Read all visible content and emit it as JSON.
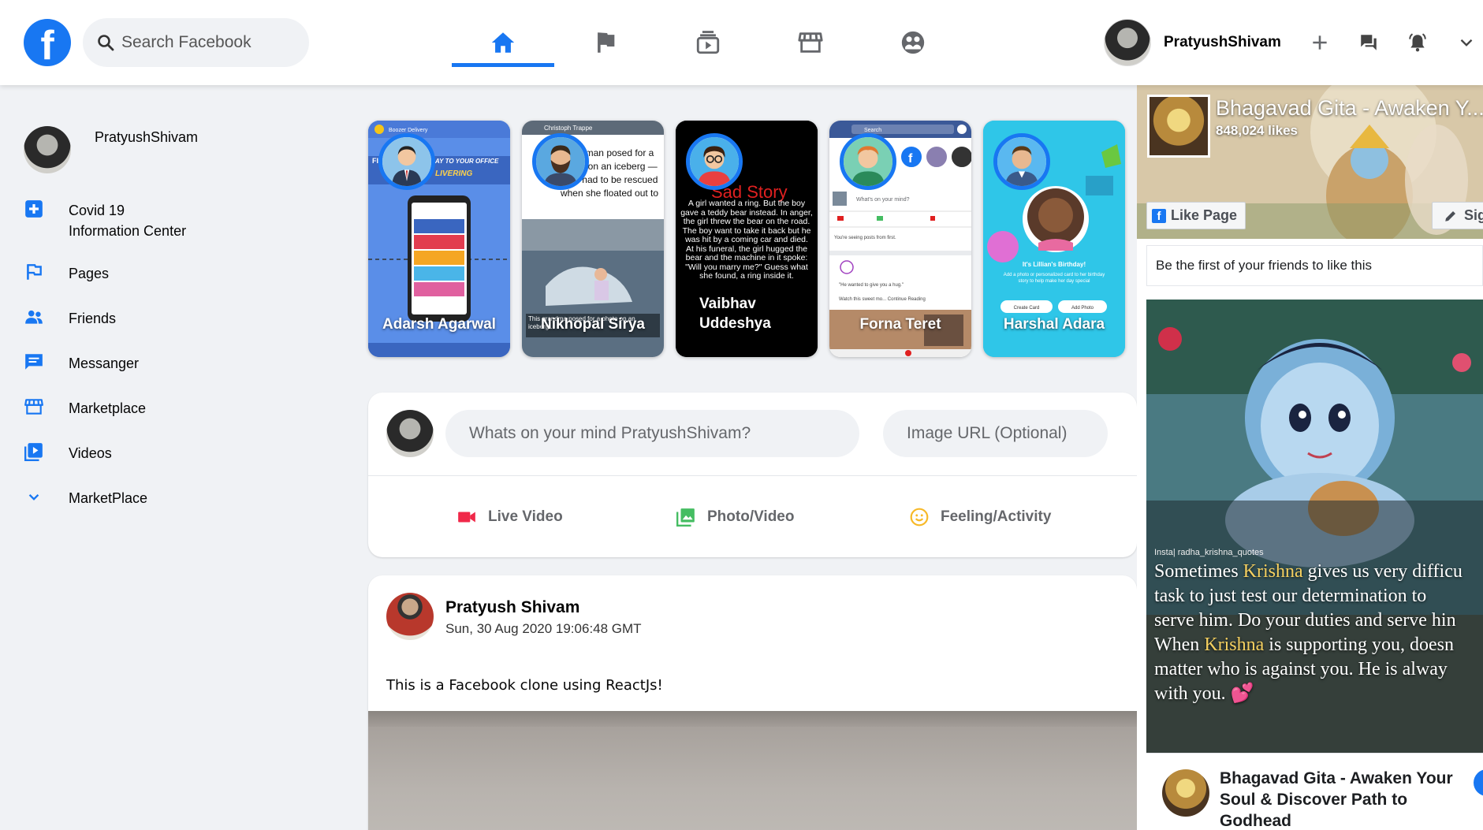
{
  "header": {
    "search_placeholder": "Search Facebook",
    "user_name": "PratyushShivam",
    "nav_tabs": [
      "home",
      "pages",
      "watch",
      "marketplace",
      "groups"
    ]
  },
  "sidebar": {
    "profile_name": "PratyushShivam",
    "items": [
      {
        "label": "Covid 19\nInformation Center",
        "line1": "Covid 19",
        "line2": "Information Center",
        "icon": "plus-square-icon"
      },
      {
        "label": "Pages",
        "icon": "flag-icon"
      },
      {
        "label": "Friends",
        "icon": "people-icon"
      },
      {
        "label": "Messanger",
        "icon": "chat-icon"
      },
      {
        "label": "Marketplace",
        "icon": "store-icon"
      },
      {
        "label": "Videos",
        "icon": "video-library-icon"
      },
      {
        "label": "MarketPlace",
        "icon": "chevron-down-icon"
      }
    ]
  },
  "stories": [
    {
      "name": "Adarsh Agarwal"
    },
    {
      "name": "Nikhopal Sirya"
    },
    {
      "name": "Vaibhav Uddeshya",
      "line1": "Vaibhav",
      "line2": "Uddeshya"
    },
    {
      "name": "Forna Teret"
    },
    {
      "name": "Harshal Adara"
    }
  ],
  "story_content": {
    "s1_header": "Boozer Delivery",
    "s1_banner_left": "FI",
    "s1_banner_right": "AY TO YOUR OFFICE",
    "s1_banner_sub": "LIVERING",
    "s2_header": "Christoph Trappe",
    "s2_text": "A woman posed for a photo on an iceberg — then had to be rescued when she floated out to sea",
    "s2_caption": "This grandma posed for a photo on an iceberg...",
    "s3_title": "Sad Story",
    "s3_text": "A girl wanted a ring. But the boy gave a teddy bear instead. In anger, the girl threw the bear on the road. The boy want to take it back but he was hit by a coming car and died. At his funeral, the girl hugged the bear and the machine in it spoke: \"Will you marry me?\" Guess what she found, a ring inside it.",
    "s4_search": "Search",
    "s4_prompt": "What's on your mind?",
    "s4_seeing": "You're seeing posts from first.",
    "s4_quote": "\"He wanted to give you a hug.\"",
    "s4_watch": "Watch this sweet mo... Continue Reading",
    "s5_title": "It's Lillian's Birthday!",
    "s5_sub": "Add a photo or personalized card to her birthday story to help make her day special",
    "s5_btn1": "Create Card",
    "s5_btn2": "Add Photo"
  },
  "composer": {
    "text_placeholder": "Whats on your mind PratyushShivam?",
    "url_placeholder": "Image URL (Optional)",
    "options": [
      {
        "label": "Live Video",
        "icon": "videocam-icon",
        "color": "#f02849"
      },
      {
        "label": "Photo/Video",
        "icon": "photo-library-icon",
        "color": "#45bd62"
      },
      {
        "label": "Feeling/Activity",
        "icon": "emoji-icon",
        "color": "#f7b928"
      }
    ]
  },
  "post": {
    "author": "Pratyush Shivam",
    "timestamp": "Sun, 30 Aug 2020 19:06:48 GMT",
    "text": "This is a Facebook clone using ReactJs!"
  },
  "widget": {
    "page_title": "Bhagavad Gita - Awaken Y...",
    "likes": "848,024 likes",
    "like_button": "Like Page",
    "sign_button": "Sig",
    "friends_text": "Be the first of your friends to like this",
    "insta_tag": "Insta| radha_krishna_quotes",
    "quote_lines": [
      [
        "Sometimes ",
        "Krishna",
        " gives us very difficu"
      ],
      [
        "task to just test our determination to",
        "",
        ""
      ],
      [
        "serve him. Do your duties and serve hin",
        "",
        ""
      ],
      [
        "When ",
        "Krishna",
        " is supporting you, doesn"
      ],
      [
        "matter who is against you. He is alway",
        "",
        ""
      ],
      [
        "with you. 💕",
        "",
        ""
      ]
    ],
    "footer_title": "Bhagavad Gita - Awaken Your Soul & Discover Path to Godhead"
  },
  "colors": {
    "brand": "#1877f2",
    "background": "#f0f2f5",
    "live": "#f02849",
    "photo": "#45bd62",
    "feeling": "#f7b928"
  }
}
